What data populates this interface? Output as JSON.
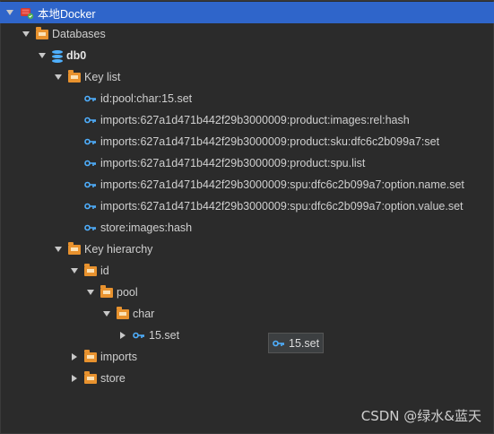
{
  "tree": {
    "root": {
      "label": "本地Docker"
    },
    "databases": {
      "label": "Databases"
    },
    "db0": {
      "label": "db0"
    },
    "key_list": {
      "label": "Key list",
      "keys": [
        "id:pool:char:15.set",
        "imports:627a1d471b442f29b3000009:product:images:rel:hash",
        "imports:627a1d471b442f29b3000009:product:sku:dfc6c2b099a7:set",
        "imports:627a1d471b442f29b3000009:product:spu.list",
        "imports:627a1d471b442f29b3000009:spu:dfc6c2b099a7:option.name.set",
        "imports:627a1d471b442f29b3000009:spu:dfc6c2b099a7:option.value.set",
        "store:images:hash"
      ]
    },
    "key_hierarchy": {
      "label": "Key hierarchy",
      "id": "id",
      "pool": "pool",
      "char": "char",
      "leaf": "15.set",
      "imports": "imports",
      "store": "store"
    }
  },
  "tooltip": {
    "label": "15.set"
  },
  "watermark": {
    "text": "CSDN @绿水&蓝天"
  },
  "colors": {
    "selection": "#2f65ca",
    "background": "#2b2b2b",
    "folder": "#e8922e",
    "key_icon": "#4fb0ff"
  },
  "icons": {
    "key": "key-icon",
    "folder": "folder-icon",
    "database": "database-icon",
    "redis": "redis-server-icon"
  }
}
